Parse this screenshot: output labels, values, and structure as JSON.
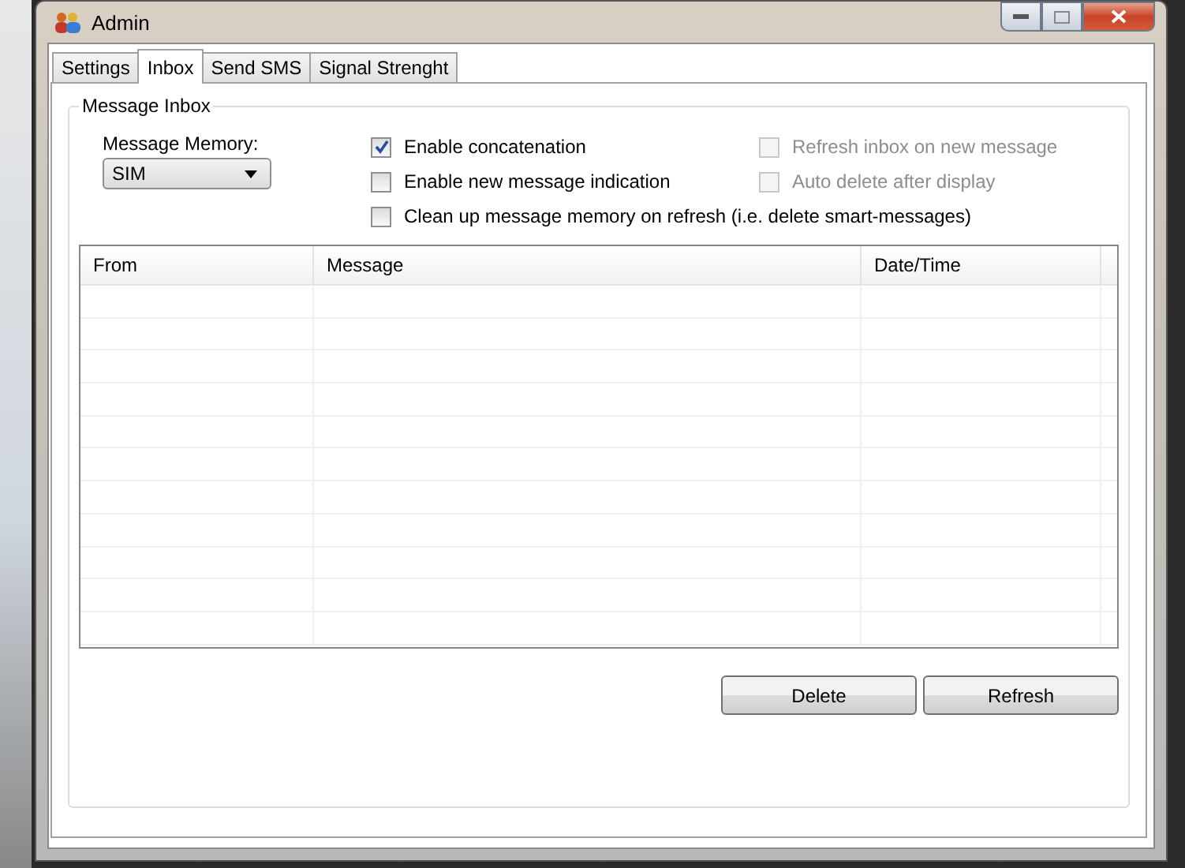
{
  "window": {
    "title": "Admin"
  },
  "tabs": [
    {
      "label": "Settings",
      "selected": false
    },
    {
      "label": "Inbox",
      "selected": true
    },
    {
      "label": "Send SMS",
      "selected": false
    },
    {
      "label": "Signal Strenght",
      "selected": false
    }
  ],
  "group": {
    "title": "Message Inbox"
  },
  "memory": {
    "label": "Message Memory:",
    "value": "SIM"
  },
  "options": [
    {
      "label": "Enable concatenation",
      "checked": true,
      "disabled": false
    },
    {
      "label": "Refresh inbox on new message",
      "checked": false,
      "disabled": true
    },
    {
      "label": "Enable new message indication",
      "checked": false,
      "disabled": false
    },
    {
      "label": "Auto delete after display",
      "checked": false,
      "disabled": true
    },
    {
      "label": "Clean up message memory on refresh (i.e. delete smart-messages)",
      "checked": false,
      "disabled": false
    }
  ],
  "table": {
    "columns": [
      "From",
      "Message",
      "Date/Time"
    ]
  },
  "buttons": [
    "Delete",
    "Refresh"
  ]
}
